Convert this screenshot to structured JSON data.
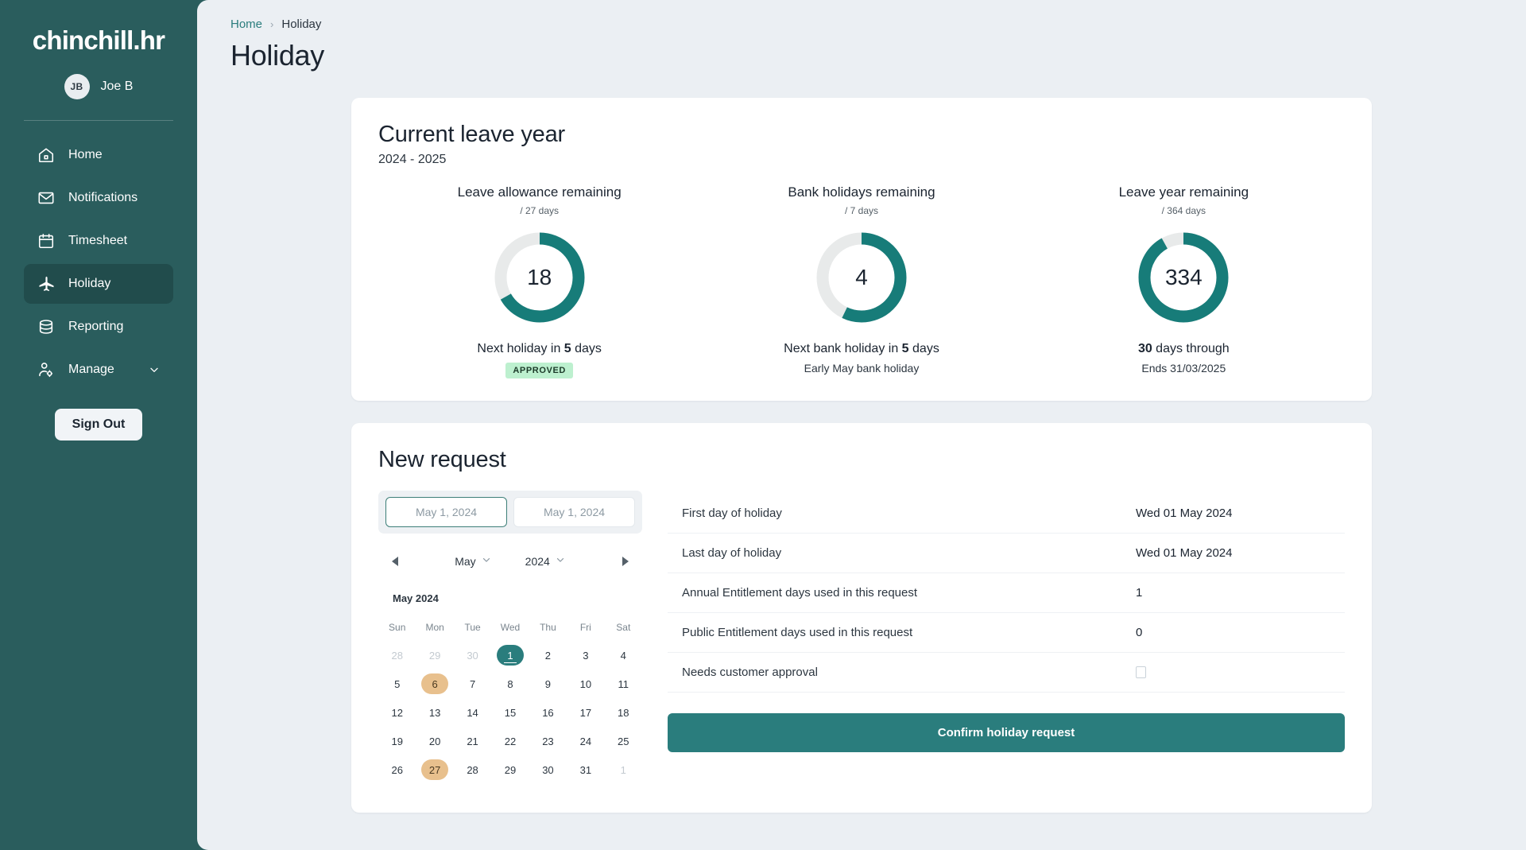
{
  "sidebar": {
    "brand": "chinchill.hr",
    "user": {
      "initials": "JB",
      "name": "Joe B"
    },
    "items": [
      {
        "label": "Home",
        "icon": "home-icon",
        "active": false
      },
      {
        "label": "Notifications",
        "icon": "envelope-icon",
        "active": false
      },
      {
        "label": "Timesheet",
        "icon": "calendar-icon",
        "active": false
      },
      {
        "label": "Holiday",
        "icon": "airplane-icon",
        "active": true
      },
      {
        "label": "Reporting",
        "icon": "database-icon",
        "active": false
      },
      {
        "label": "Manage",
        "icon": "user-gear-icon",
        "active": false,
        "chevron": true
      }
    ],
    "sign_out": "Sign Out"
  },
  "breadcrumb": {
    "home": "Home",
    "separator": "›",
    "current": "Holiday"
  },
  "page_title": "Holiday",
  "leave_card": {
    "title": "Current leave year",
    "subtitle": "2024 - 2025",
    "stats": [
      {
        "title": "Leave allowance remaining",
        "denominator": "/ 27 days",
        "value": "18",
        "total": 27,
        "used": 18,
        "percent": 66.7,
        "footer_prefix": "Next holiday in ",
        "footer_bold": "5",
        "footer_suffix": " days",
        "badge": "APPROVED",
        "sub": ""
      },
      {
        "title": "Bank holidays remaining",
        "denominator": "/ 7 days",
        "value": "4",
        "total": 7,
        "used": 4,
        "percent": 57.1,
        "footer_prefix": "Next bank holiday in ",
        "footer_bold": "5",
        "footer_suffix": " days",
        "badge": "",
        "sub": "Early May bank holiday"
      },
      {
        "title": "Leave year remaining",
        "denominator": "/ 364 days",
        "value": "334",
        "total": 364,
        "used": 334,
        "percent": 91.8,
        "footer_prefix": "",
        "footer_bold": "30",
        "footer_suffix": " days through",
        "badge": "",
        "sub": "Ends 31/03/2025"
      }
    ]
  },
  "request_card": {
    "title": "New request",
    "date_tabs": [
      {
        "value": "May 1, 2024",
        "selected": true
      },
      {
        "value": "May 1, 2024",
        "selected": false
      }
    ],
    "calendar": {
      "prev_label": "previous-month",
      "next_label": "next-month",
      "month_select": "May",
      "year_select": "2024",
      "caption": "May 2024",
      "day_names": [
        "Sun",
        "Mon",
        "Tue",
        "Wed",
        "Thu",
        "Fri",
        "Sat"
      ],
      "weeks": [
        [
          {
            "d": "28",
            "state": "muted"
          },
          {
            "d": "29",
            "state": "muted"
          },
          {
            "d": "30",
            "state": "muted"
          },
          {
            "d": "1",
            "state": "today"
          },
          {
            "d": "2",
            "state": "normal"
          },
          {
            "d": "3",
            "state": "normal"
          },
          {
            "d": "4",
            "state": "normal"
          }
        ],
        [
          {
            "d": "5",
            "state": "normal"
          },
          {
            "d": "6",
            "state": "hol"
          },
          {
            "d": "7",
            "state": "normal"
          },
          {
            "d": "8",
            "state": "normal"
          },
          {
            "d": "9",
            "state": "normal"
          },
          {
            "d": "10",
            "state": "normal"
          },
          {
            "d": "11",
            "state": "normal"
          }
        ],
        [
          {
            "d": "12",
            "state": "normal"
          },
          {
            "d": "13",
            "state": "normal"
          },
          {
            "d": "14",
            "state": "normal"
          },
          {
            "d": "15",
            "state": "normal"
          },
          {
            "d": "16",
            "state": "normal"
          },
          {
            "d": "17",
            "state": "normal"
          },
          {
            "d": "18",
            "state": "normal"
          }
        ],
        [
          {
            "d": "19",
            "state": "normal"
          },
          {
            "d": "20",
            "state": "normal"
          },
          {
            "d": "21",
            "state": "normal"
          },
          {
            "d": "22",
            "state": "normal"
          },
          {
            "d": "23",
            "state": "normal"
          },
          {
            "d": "24",
            "state": "normal"
          },
          {
            "d": "25",
            "state": "normal"
          }
        ],
        [
          {
            "d": "26",
            "state": "normal"
          },
          {
            "d": "27",
            "state": "hol"
          },
          {
            "d": "28",
            "state": "normal"
          },
          {
            "d": "29",
            "state": "normal"
          },
          {
            "d": "30",
            "state": "normal"
          },
          {
            "d": "31",
            "state": "normal"
          },
          {
            "d": "1",
            "state": "muted"
          }
        ]
      ]
    },
    "details": [
      {
        "label": "First day of holiday",
        "value": "Wed 01 May 2024",
        "type": "text"
      },
      {
        "label": "Last day of holiday",
        "value": "Wed 01 May 2024",
        "type": "text"
      },
      {
        "label": "Annual Entitlement days used in this request",
        "value": "1",
        "type": "text"
      },
      {
        "label": "Public Entitlement days used in this request",
        "value": "0",
        "type": "text"
      },
      {
        "label": "Needs customer approval",
        "value": "",
        "type": "checkbox",
        "checked": false
      }
    ],
    "confirm_label": "Confirm holiday request"
  },
  "colors": {
    "sidebar": "#2a5d5d",
    "sidebar_active": "#214c4c",
    "accent": "#2a7d7d",
    "page_bg": "#ebeff3",
    "donut_track": "#e8eaea",
    "holiday_highlight": "#e8c08d",
    "badge_bg": "#bdf0cf"
  }
}
